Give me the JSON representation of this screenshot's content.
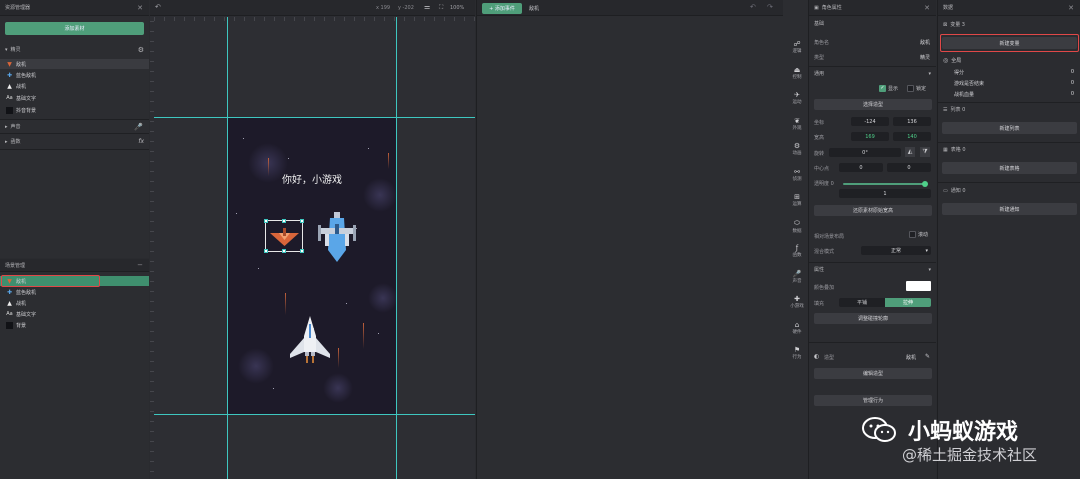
{
  "scene_panel": {
    "title": "资源管理器",
    "add_asset_button": "添加素材",
    "sprites_section": "精灵",
    "sprites": [
      {
        "label": "敌机",
        "icon": "enemy-plane-icon"
      },
      {
        "label": "蓝色敌机",
        "icon": "blue-plane-icon"
      },
      {
        "label": "战机",
        "icon": "fighter-icon"
      },
      {
        "label": "基础文字",
        "icon": "text-icon"
      },
      {
        "label": "抖音背景",
        "icon": "background-icon"
      }
    ],
    "sound_section": "声音",
    "function_section": "函数"
  },
  "layer_panel": {
    "title": "场景管理",
    "items": [
      {
        "label": "敌机"
      },
      {
        "label": "蓝色敌机"
      },
      {
        "label": "战机"
      },
      {
        "label": "基础文字"
      },
      {
        "label": "背景"
      }
    ]
  },
  "canvas_toolbar": {
    "x_readout": "x 199",
    "y_readout": "y -202",
    "zoom": "100%"
  },
  "canvas": {
    "title_text": "你好，小游戏"
  },
  "event_panel": {
    "add_event_button": "+ 添加事件",
    "target": "敌机"
  },
  "side_icons": [
    {
      "label": "逻辑",
      "glyph": "☍",
      "color": "#7b6fd6"
    },
    {
      "label": "控制",
      "glyph": "⏏",
      "color": "#d59a4a"
    },
    {
      "label": "运动",
      "glyph": "✈",
      "color": "#7b6fd6"
    },
    {
      "label": "外观",
      "glyph": "❦",
      "color": "#c66fb0"
    },
    {
      "label": "动画",
      "glyph": "⚙",
      "color": "#4fa88a"
    },
    {
      "label": "侦测",
      "glyph": "⚯",
      "color": "#5a9ad6"
    },
    {
      "label": "运算",
      "glyph": "⊞",
      "color": "#6fb04f"
    },
    {
      "label": "数据",
      "glyph": "⬭",
      "color": "#d6804a"
    },
    {
      "label": "函数",
      "glyph": "ƒ",
      "color": "#c65a5a"
    },
    {
      "label": "声音",
      "glyph": "🎤",
      "color": "#b0a050"
    },
    {
      "label": "小游戏",
      "glyph": "✚",
      "color": "#5ab0c6"
    },
    {
      "label": "硬件",
      "glyph": "⌂",
      "color": "#d6a84a"
    },
    {
      "label": "行为",
      "glyph": "⚑",
      "color": "#d67a4a"
    }
  ],
  "props_panel": {
    "title": "角色属性",
    "basic_section": "基础",
    "role_name_label": "角色名",
    "role_name_value": "敌机",
    "type_label": "类型",
    "type_value": "精灵",
    "common_section": "通用",
    "show_label": "显示",
    "lock_label": "锁定",
    "select_shape_button": "选择造型",
    "coord_label": "坐标",
    "coord_x": "-124",
    "coord_y": "136",
    "size_label": "宽高",
    "size_w": "169",
    "size_h": "140",
    "rotation_label": "旋转",
    "rotation_value": "0°",
    "center_label": "中心点",
    "center_x": "0",
    "center_y": "0",
    "opacity_label": "透明度 0",
    "opacity_value": "1",
    "opacity_fraction": 0.98,
    "restore_button": "还原素材原始宽高",
    "pivot_label": "相对场景布局",
    "pivot_opt": "滚动",
    "blend_label": "混合模式",
    "blend_value": "正常",
    "attr_section": "属性",
    "color_label": "颜色叠加",
    "color_value": "#ffffff",
    "fill_label": "填充",
    "fill_opt1": "平铺",
    "fill_opt2": "拉伸",
    "collision_button": "调整碰撞轮廓",
    "costume_label": "造型",
    "costume_value": "敌机",
    "edit_costume_button": "编辑造型",
    "manage_behavior_button": "管理行为"
  },
  "data_panel": {
    "title": "数据",
    "vars_section": "变量 3",
    "new_var_button": "新建变量",
    "global_label": "全局",
    "vars": [
      {
        "name": "得分",
        "value": "0"
      },
      {
        "name": "游戏是否结束",
        "value": "0"
      },
      {
        "name": "战机血量",
        "value": "0"
      }
    ],
    "list_section": "列表 0",
    "new_list_button": "新建列表",
    "table_section": "表格 0",
    "new_table_button": "新建表格",
    "notice_section": "通知 0",
    "new_notice_button": "新建通知"
  },
  "watermark": {
    "brand": "小蚂蚁游戏",
    "source": "@稀土掘金技术社区"
  },
  "colors": {
    "accent_green": "#4f9e7a",
    "highlight_red": "#e04848",
    "guide_cyan": "#3ec7c0"
  }
}
